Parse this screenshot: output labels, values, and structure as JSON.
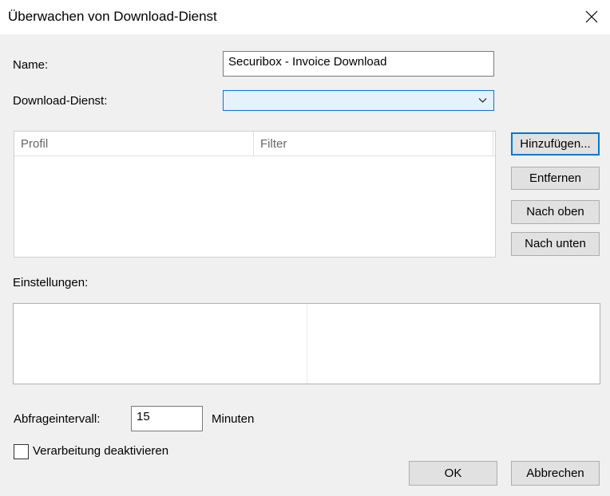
{
  "window": {
    "title": "Überwachen von Download-Dienst",
    "close_icon": "close-icon"
  },
  "form": {
    "name_label": "Name:",
    "name_value": "Securibox - Invoice Download",
    "service_label": "Download-Dienst:",
    "service_value": "",
    "service_dropdown_icon": "chevron-down-icon"
  },
  "profiles": {
    "columns": [
      "Profil",
      "Filter"
    ],
    "rows": []
  },
  "profile_buttons": {
    "add": "Hinzufügen...",
    "remove": "Entfernen",
    "up": "Nach oben",
    "down": "Nach unten"
  },
  "settings": {
    "label": "Einstellungen:"
  },
  "polling": {
    "label": "Abfrageintervall:",
    "value": "15",
    "unit": "Minuten"
  },
  "disable_processing": {
    "label": "Verarbeitung deaktivieren",
    "checked": false
  },
  "footer": {
    "ok": "OK",
    "cancel": "Abbrechen"
  },
  "colors": {
    "dialog_background": "#f0f0f0",
    "accent": "#0078d7",
    "combo_background": "#e5f1fb",
    "button_background": "#e1e1e1"
  }
}
